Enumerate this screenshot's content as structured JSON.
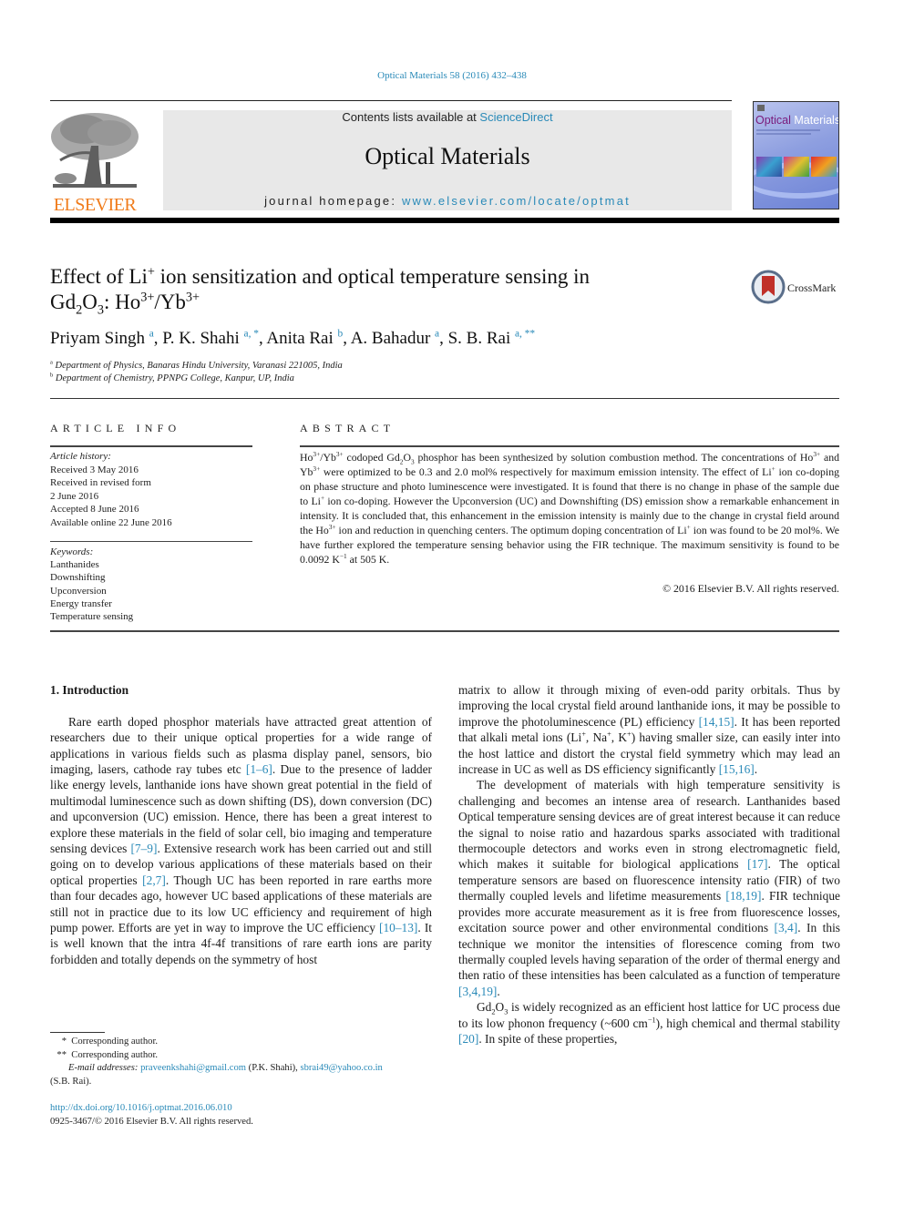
{
  "header": {
    "citation": "Optical Materials 58 (2016) 432–438",
    "publisher_wordmark": "ELSEVIER",
    "contents_prefix": "Contents lists available at ",
    "contents_link": "ScienceDirect",
    "journal_title": "Optical Materials",
    "homepage_prefix": "journal homepage: ",
    "homepage_link": "www.elsevier.com/locate/optmat",
    "cover_title_part1": "Optical",
    "cover_title_part2": " Materials",
    "crossmark_label": "CrossMark",
    "colors": {
      "link": "#2a8ab8",
      "elsevier_orange": "#f07c1c",
      "masthead_bg": "#e8e8e8"
    }
  },
  "article": {
    "title_line1_a": "Effect of Li",
    "title_line1_sup": "+",
    "title_line1_b": " ion sensitization and optical temperature sensing in",
    "title_line2": {
      "gd": "Gd",
      "sub2": "2",
      "o": "O",
      "sub3": "3",
      "ho": ": Ho",
      "sup_ho": "3+",
      "yb": "/Yb",
      "sup_yb": "3+"
    },
    "authors": [
      {
        "name": "Priyam Singh",
        "mark": "a"
      },
      {
        "name": "P. K. Shahi",
        "mark": "a, *"
      },
      {
        "name": "Anita Rai",
        "mark": "b"
      },
      {
        "name": "A. Bahadur",
        "mark": "a"
      },
      {
        "name": "S. B. Rai",
        "mark": "a, **"
      }
    ],
    "affiliations": [
      {
        "mark": "a",
        "text": "Department of Physics, Banaras Hindu University, Varanasi 221005, India"
      },
      {
        "mark": "b",
        "text": "Department of Chemistry, PPNPG College, Kanpur, UP, India"
      }
    ]
  },
  "article_info": {
    "heading": "ARTICLE INFO",
    "history_label": "Article history:",
    "history": [
      "Received 3 May 2016",
      "Received in revised form",
      "2 June 2016",
      "Accepted 8 June 2016",
      "Available online 22 June 2016"
    ],
    "keywords_label": "Keywords:",
    "keywords": [
      "Lanthanides",
      "Downshifting",
      "Upconversion",
      "Energy transfer",
      "Temperature sensing"
    ]
  },
  "abstract": {
    "heading": "ABSTRACT",
    "segments": [
      "Ho",
      "3+",
      "/Yb",
      "3+",
      " codoped Gd",
      "2",
      "O",
      "3",
      " phosphor has been synthesized by solution combustion method. The concentrations of Ho",
      "3+",
      " and Yb",
      "3+",
      " were optimized to be 0.3 and 2.0 mol% respectively for maximum emission intensity. The effect of Li",
      "+",
      " ion co-doping on phase structure and photo luminescence were investigated. It is found that there is no change in phase of the sample due to Li",
      "+",
      " ion co-doping. However the Upconversion (UC) and Downshifting (DS) emission show a remarkable enhancement in intensity. It is concluded that, this enhancement in the emission intensity is mainly due to the change in crystal field around the Ho",
      "3+",
      " ion and reduction in quenching centers. The optimum doping concentration of Li",
      "+",
      " ion was found to be 20 mol%. We have further explored the temperature sensing behavior using the FIR technique. The maximum sensitivity is found to be 0.0092 K",
      "−1",
      " at 505 K."
    ],
    "copyright": "© 2016 Elsevier B.V. All rights reserved."
  },
  "body": {
    "section_heading": "1.  Introduction",
    "left_para": [
      "Rare earth doped phosphor materials have attracted great attention of researchers due to their unique optical properties for a wide range of applications in various fields such as plasma display panel, sensors, bio imaging, lasers, cathode ray tubes etc ",
      "[1–6]",
      ". Due to the presence of ladder like energy levels, lanthanide ions have shown great potential in the field of multimodal luminescence such as down shifting (DS), down conversion (DC) and upconversion (UC) emission. Hence, there has been a great interest to explore these materials in the field of solar cell, bio imaging and temperature sensing devices ",
      "[7–9]",
      ". Extensive research work has been carried out and still going on to develop various applications of these materials based on their optical properties ",
      "[2,7]",
      ". Though UC has been reported in rare earths more than four decades ago, however UC based applications of these materials are still not in practice due to its low UC efficiency and requirement of high pump power. Efforts are yet in way to improve the UC efficiency ",
      "[10–13]",
      ". It is well known that the intra 4f-4f transitions of rare earth ions are parity forbidden and totally depends on the symmetry of host"
    ],
    "right_para1": [
      "matrix to allow it through mixing of even-odd parity orbitals. Thus by improving the local crystal field around lanthanide ions, it may be possible to improve the photoluminescence (PL) efficiency ",
      "[14,15]",
      ". It has been reported that alkali metal ions (Li",
      "+",
      ", Na",
      "+",
      ", K",
      "+",
      ") having smaller size, can easily inter into the host lattice and distort the crystal field symmetry which may lead an increase in UC as well as DS efficiency significantly ",
      "[15,16]",
      "."
    ],
    "right_para2": [
      "The development of materials with high temperature sensitivity is challenging and becomes an intense area of research. Lanthanides based Optical temperature sensing devices are of great interest because it can reduce the signal to noise ratio and hazardous sparks associated with traditional thermocouple detectors and works even in strong electromagnetic field, which makes it suitable for biological applications ",
      "[17]",
      ". The optical temperature sensors are based on fluorescence intensity ratio (FIR) of two thermally coupled levels and lifetime measurements ",
      "[18,19]",
      ". FIR technique provides more accurate measurement as it is free from fluorescence losses, excitation source power and other environmental conditions ",
      "[3,4]",
      ". In this technique we monitor the intensities of florescence coming from two thermally coupled levels having separation of the order of thermal energy and then ratio of these intensities has been calculated as a function of temperature ",
      "[3,4,19]",
      "."
    ],
    "right_para3": [
      "Gd",
      "2",
      "O",
      "3",
      " is widely recognized as an efficient host lattice for UC process due to its low phonon frequency (~600 cm",
      "−1",
      "), high chemical and thermal stability ",
      "[20]",
      ". In spite of these properties,"
    ]
  },
  "footnotes": {
    "corr1_mark": "*",
    "corr1_text": "Corresponding author.",
    "corr2_mark": "**",
    "corr2_text": "Corresponding author.",
    "email_label": "E-mail addresses:",
    "email1": "praveenkshahi@gmail.com",
    "email1_owner": " (P.K. Shahi), ",
    "email2": "sbrai49@yahoo.co.in",
    "email2_owner": "(S.B. Rai).",
    "doi": "http://dx.doi.org/10.1016/j.optmat.2016.06.010",
    "issn": "0925-3467/© 2016 Elsevier B.V. All rights reserved."
  }
}
